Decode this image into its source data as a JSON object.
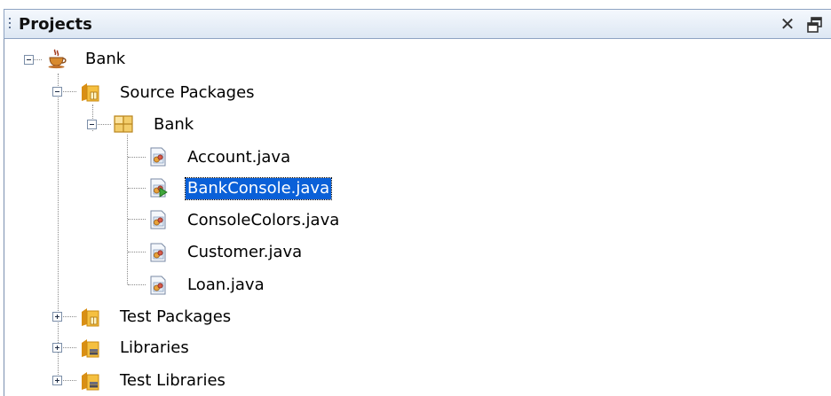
{
  "panel": {
    "title": "Projects",
    "close_symbol": "✕"
  },
  "tree": {
    "root_label": "Bank",
    "source_packages_label": "Source Packages",
    "package_label": "Bank",
    "files": [
      "Account.java",
      "BankConsole.java",
      "ConsoleColors.java",
      "Customer.java",
      "Loan.java"
    ],
    "selected_file": "BankConsole.java",
    "test_packages_label": "Test Packages",
    "libraries_label": "Libraries",
    "test_libraries_label": "Test Libraries"
  },
  "icons": {
    "project": "java-cup-icon",
    "folder": "package-folder-icon",
    "package": "package-icon",
    "java_file": "java-file-icon",
    "main_java_file": "java-main-class-icon",
    "library": "library-folder-icon",
    "close": "close-icon",
    "restore": "restore-window-icon"
  },
  "colors": {
    "selection": "#0a60d8",
    "titlebar_top": "#f4f8fd",
    "titlebar_bottom": "#dde7f3",
    "folder": "#f1b632",
    "package": "#e7b84b"
  }
}
